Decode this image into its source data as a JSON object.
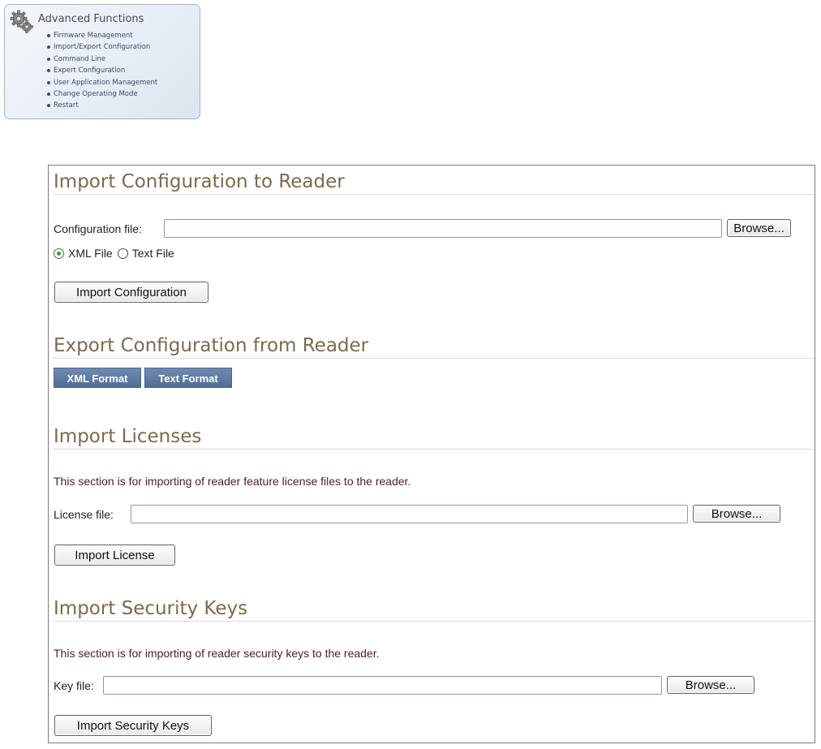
{
  "advanced": {
    "title": "Advanced Functions",
    "items": [
      "Firmware Management",
      "Import/Export Configuration",
      "Command Line",
      "Expert Configuration",
      "User Application Management",
      "Change Operating Mode",
      "Restart"
    ]
  },
  "import_config": {
    "heading": "Import Configuration to Reader",
    "file_label": "Configuration file:",
    "file_value": "",
    "browse_label": "Browse...",
    "format_options": [
      {
        "label": "XML File",
        "selected": true
      },
      {
        "label": "Text File",
        "selected": false
      }
    ],
    "submit_label": "Import Configuration"
  },
  "export_config": {
    "heading": "Export Configuration from Reader",
    "xml_label": "XML Format",
    "text_label": "Text Format"
  },
  "import_licenses": {
    "heading": "Import Licenses",
    "description": "This section is for importing of reader feature license files to the reader.",
    "file_label": "License file:",
    "file_value": "",
    "browse_label": "Browse...",
    "submit_label": "Import License"
  },
  "import_keys": {
    "heading": "Import Security Keys",
    "description": "This section is for importing of reader security keys to the reader.",
    "file_label": "Key file:",
    "file_value": "",
    "browse_label": "Browse...",
    "submit_label": "Import Security Keys"
  },
  "colors": {
    "heading": "#7a6b4d",
    "description": "#4d1a33",
    "export_button": "#5f7ca3",
    "radio_selected": "#3a9a3a"
  },
  "icons": {
    "advanced": "gears-icon"
  }
}
